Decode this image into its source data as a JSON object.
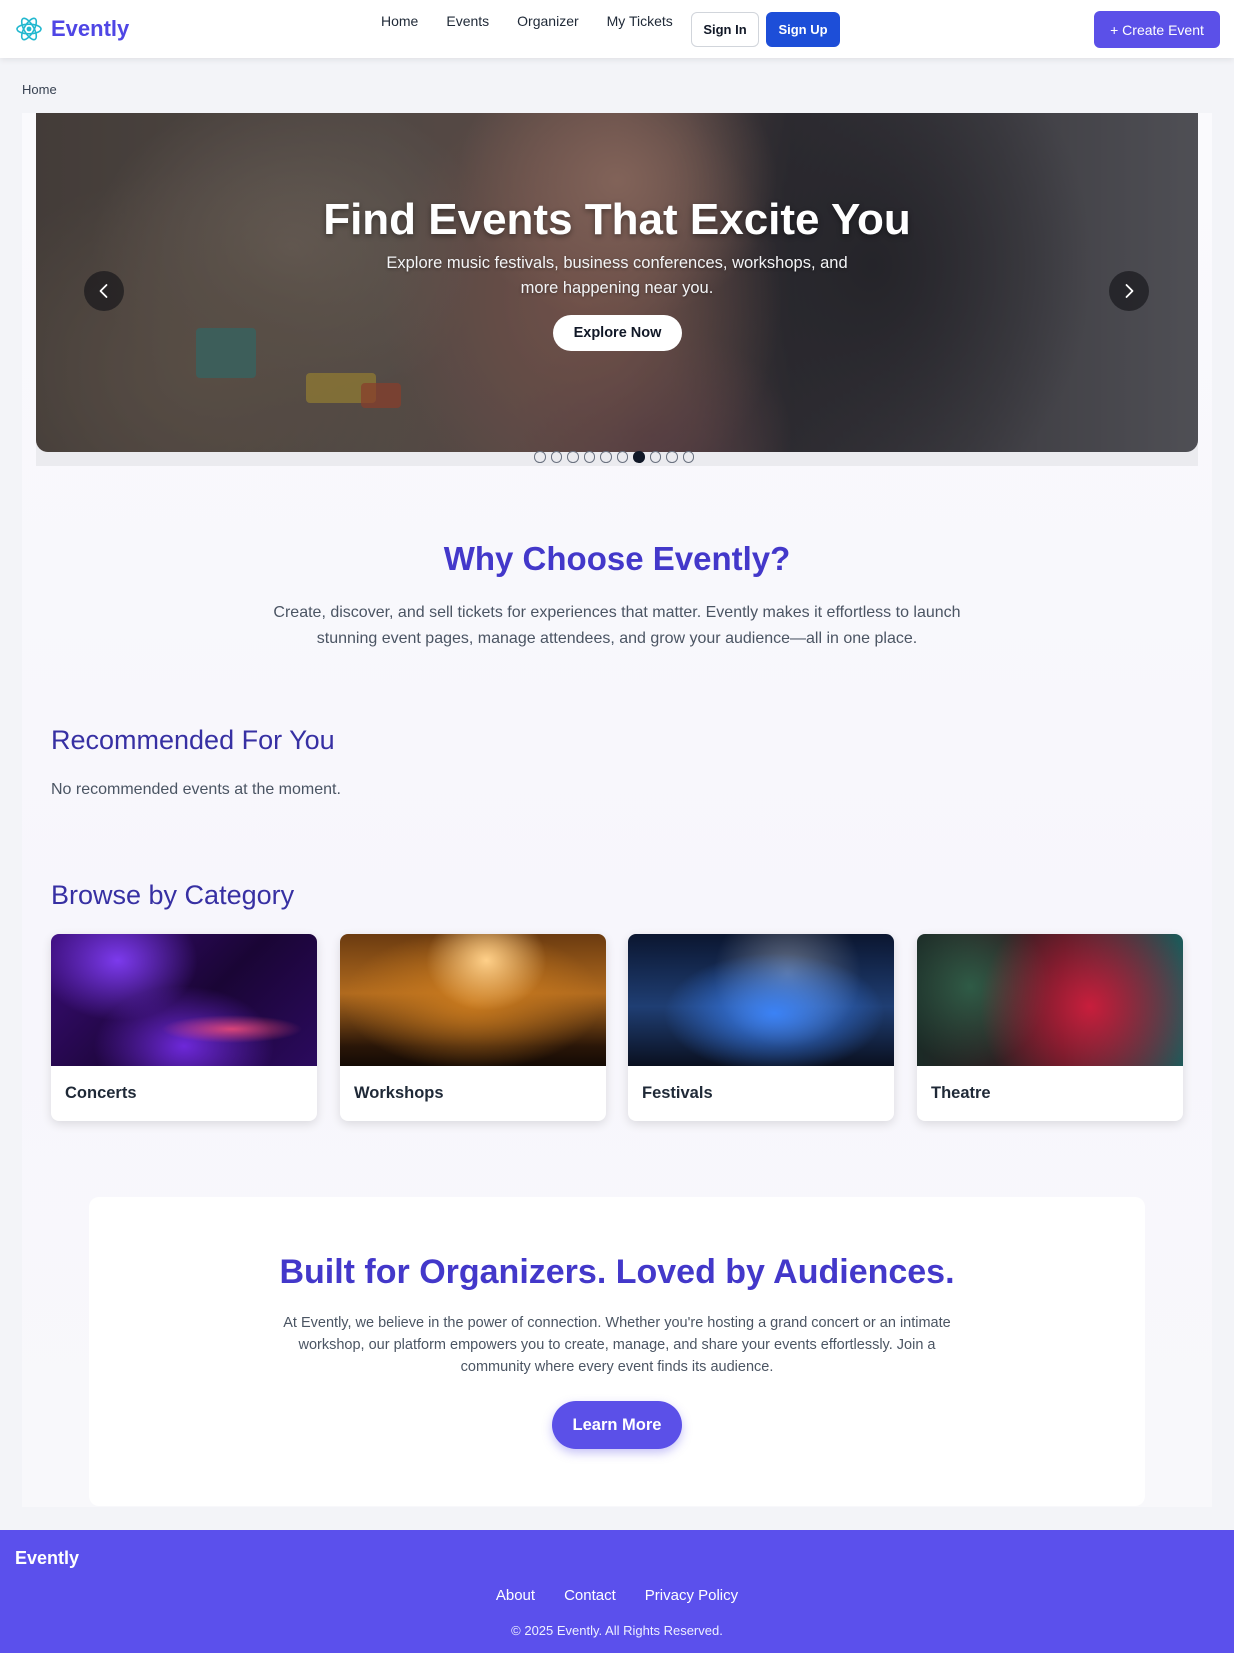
{
  "brand": {
    "name": "Evently",
    "logo_icon": "atom-icon",
    "accent": "#4f46e5",
    "logo_color": "#22b8cf"
  },
  "nav": {
    "links": [
      "Home",
      "Events",
      "Organizer",
      "My Tickets"
    ],
    "sign_in": "Sign In",
    "sign_up": "Sign Up",
    "create_event": "+ Create Event"
  },
  "breadcrumb": "Home",
  "hero": {
    "title": "Find Events That Excite You",
    "subtitle": "Explore music festivals, business conferences, workshops, and more happening near you.",
    "cta": "Explore Now",
    "prev_icon": "chevron-left-icon",
    "next_icon": "chevron-right-icon",
    "slide_count": 10,
    "active_slide": 7
  },
  "why": {
    "title": "Why Choose Evently?",
    "text": "Create, discover, and sell tickets for experiences that matter. Evently makes it effortless to launch stunning event pages, manage attendees, and grow your audience—all in one place."
  },
  "recommended": {
    "title": "Recommended For You",
    "empty_text": "No recommended events at the moment."
  },
  "categories": {
    "title": "Browse by Category",
    "items": [
      {
        "name": "Concerts"
      },
      {
        "name": "Workshops"
      },
      {
        "name": "Festivals"
      },
      {
        "name": "Theatre"
      }
    ]
  },
  "organizers": {
    "title": "Built for Organizers. Loved by Audiences.",
    "text": "At Evently, we believe in the power of connection. Whether you're hosting a grand concert or an intimate workshop, our platform empowers you to create, manage, and share your events effortlessly. Join a community where every event finds its audience.",
    "cta": "Learn More"
  },
  "footer": {
    "brand": "Evently",
    "links": [
      "About",
      "Contact",
      "Privacy Policy"
    ],
    "copyright": "© 2025 Evently. All Rights Reserved.",
    "background": "#5b50ec"
  }
}
